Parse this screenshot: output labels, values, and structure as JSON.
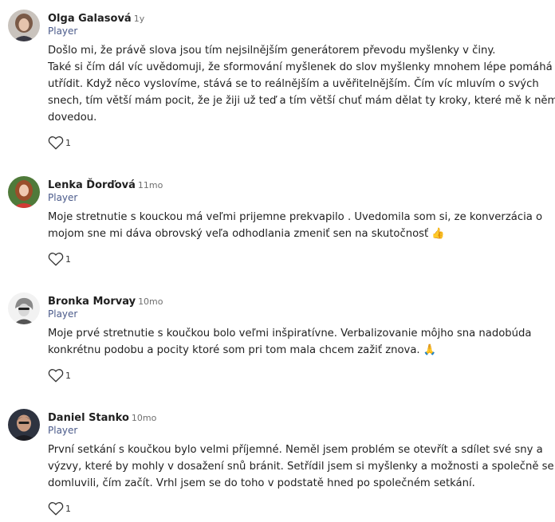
{
  "comments": [
    {
      "author": "Olga Galasová",
      "time": "1y",
      "role": "Player",
      "lines": [
        "Došlo mi, že právě slova jsou tím nejsilnějším generátorem převodu myšlenky v činy.",
        "Také si čím dál víc uvědomuji, že sformování myšlenek do slov myšlenky mnohem lépe pomáhá",
        "utřídit. Když něco vyslovíme, stává se to reálnějším a uvěřitelnějším. Čím víc mluvím o svých",
        "snech, tím větší mám pocit, že je žiji už teď a tím větší chuť mám dělat ty kroky, které mě k němu",
        "dovedou."
      ],
      "likes": "1"
    },
    {
      "author": "Lenka Ďorďová",
      "time": "11mo",
      "role": "Player",
      "lines": [
        "Moje stretnutie s kouckou má veľmi prijemne prekvapilo . Uvedomila som si, ze konverzácia o",
        "mojom sne mi dáva obrovský veľa odhodlania zmeniť sen na skutočnosť 👍"
      ],
      "likes": "1"
    },
    {
      "author": "Bronka Morvay",
      "time": "10mo",
      "role": "Player",
      "lines": [
        "Moje prvé stretnutie s koučkou bolo veľmi inšpiratívne. Verbalizovanie môjho sna nadobúda",
        "konkrétnu podobu a pocity ktoré som pri tom mala chcem zažiť znova. 🙏"
      ],
      "likes": "1"
    },
    {
      "author": "Daniel Stanko",
      "time": "10mo",
      "role": "Player",
      "lines": [
        "První setkání s koučkou bylo velmi příjemné. Neměl jsem problém se otevřít a sdílet své sny a",
        "výzvy, které by mohly v dosažení snů bránit. Setřídil jsem si myšlenky a možnosti a společně se",
        "domluvili, čím začít. Vrhl jsem se do toho v podstatě hned po společném setkání."
      ],
      "likes": "1"
    }
  ],
  "colors": {
    "role": "#4a5a8a",
    "meta": "#6f6f6f",
    "text": "#222222"
  },
  "icons": {
    "like": "heart-outline-icon"
  }
}
